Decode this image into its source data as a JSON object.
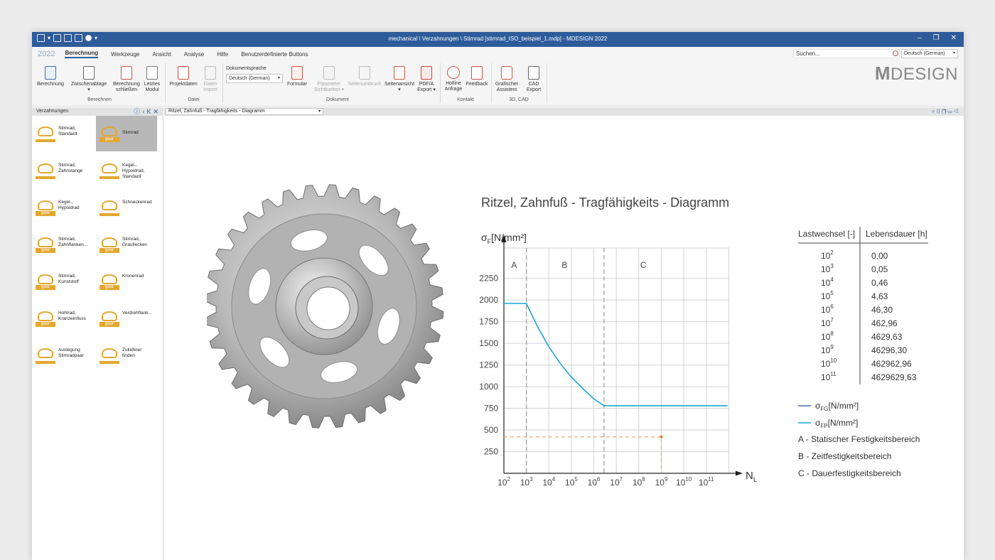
{
  "window": {
    "title": "mechanical \\ Verzahnungen \\ Stirnrad [stirnrad_ISO_beispiel_1.mdp] - MDESIGN 2022",
    "controls": [
      "–",
      "❐",
      "✕"
    ]
  },
  "menu": {
    "year": "2022",
    "items": [
      "Berechnung",
      "Werkzeuge",
      "Ansicht",
      "Analyse",
      "Hilfe",
      "Benutzerdefinierte Buttons"
    ],
    "search_text": "Suchen...",
    "language": "Deutsch (German)"
  },
  "ribbon": {
    "berechnen": {
      "group": "Berechnen",
      "buttons": [
        {
          "label1": "Berechnung",
          "label2": ""
        },
        {
          "label1": "Zwischenablage",
          "label2": "▾"
        },
        {
          "label1": "Berechnung",
          "label2": "schließen"
        },
        {
          "label1": "Letztes",
          "label2": "Modul"
        }
      ]
    },
    "datei": {
      "group": "Datei",
      "buttons": [
        {
          "label1": "Projektdaten",
          "label2": ""
        },
        {
          "label1": "Daten",
          "label2": "Import"
        }
      ]
    },
    "dokument": {
      "group": "Dokument",
      "sprache_label": "Dokumentsprache",
      "sprache_value": "Deutsch (German)",
      "buttons": [
        {
          "label1": "Formular",
          "label2": ""
        },
        {
          "label1": "Parameter",
          "label2": "Sichtbarkeit ▾"
        },
        {
          "label1": "Seitenumbruch",
          "label2": ""
        },
        {
          "label1": "Seitenansicht",
          "label2": "▾"
        },
        {
          "label1": "PDF/A",
          "label2": "Export ▾"
        }
      ]
    },
    "kontakt": {
      "group": "Kontakt",
      "buttons": [
        {
          "label1": "Hotline",
          "label2": "Anfrage"
        },
        {
          "label1": "Feedback",
          "label2": ""
        }
      ]
    },
    "cad": {
      "group": "3D, CAD",
      "buttons": [
        {
          "label1": "Grafischer",
          "label2": "Assistent"
        },
        {
          "label1": "CAD",
          "label2": "Export"
        }
      ]
    },
    "logo_m": "M",
    "logo_rest": "DESIGN"
  },
  "sidebar": {
    "title": "Verzahnungen",
    "items": [
      {
        "label1": "Stirnrad,",
        "label2": "Standard",
        "label3": "",
        "tag": ""
      },
      {
        "label1": "Stirnrad",
        "label2": "",
        "label3": "",
        "tag": "gear"
      },
      {
        "label1": "Stirnrad,",
        "label2": "Zahnstange",
        "label3": "",
        "tag": ""
      },
      {
        "label1": "Kegel-,",
        "label2": "Hypoidrad,",
        "label3": "Standard",
        "tag": ""
      },
      {
        "label1": "Kegel-,",
        "label2": "Hypoidrad",
        "label3": "",
        "tag": "gear"
      },
      {
        "label1": "Schneckenrad",
        "label2": "",
        "label3": "",
        "tag": ""
      },
      {
        "label1": "Stirnrad,",
        "label2": "Zahnflanken...",
        "label3": "",
        "tag": "gear"
      },
      {
        "label1": "Stirnrad,",
        "label2": "Graufiecken",
        "label3": "",
        "tag": "gear"
      },
      {
        "label1": "Stirnrad,",
        "label2": "Kunststoff",
        "label3": "",
        "tag": "gear"
      },
      {
        "label1": "Kronenrad",
        "label2": "",
        "label3": "",
        "tag": "gear"
      },
      {
        "label1": "Hohlrad,",
        "label2": "Kranzeinfluss",
        "label3": "",
        "tag": "gear"
      },
      {
        "label1": "Verdrehflank...",
        "label2": "",
        "label3": "",
        "tag": "gear"
      },
      {
        "label1": "Auslegung",
        "label2": "Stirnradpaar",
        "label3": "",
        "tag": ""
      },
      {
        "label1": "Zulieferer",
        "label2": "finden",
        "label3": "",
        "tag": ""
      }
    ]
  },
  "document": {
    "selector": "Ritzel, Zahnfuß - Tragfähigkeits - Diagramm"
  },
  "chart_data": {
    "type": "line",
    "title": "Ritzel, Zahnfuß - Tragfähigkeits - Diagramm",
    "ylabel_sym": "σ",
    "ylabel_sub": "F",
    "ylabel_unit": "[N/mm²]",
    "xlabel_sym": "N",
    "xlabel_sub": "L",
    "x_scale": "log10",
    "xlim_exp": [
      2,
      12
    ],
    "ylim": [
      0,
      2600
    ],
    "yticks": [
      250,
      500,
      750,
      1000,
      1250,
      1500,
      1750,
      2000,
      2250
    ],
    "xticks_exp": [
      "2",
      "3",
      "4",
      "5",
      "6",
      "7",
      "8",
      "9",
      "10",
      "11"
    ],
    "zones": [
      {
        "label": "A",
        "from_exp": 2,
        "to_exp": 3
      },
      {
        "label": "B",
        "from_exp": 3,
        "to_exp": 6.45
      },
      {
        "label": "C",
        "from_exp": 6.45,
        "to_exp": 12
      }
    ],
    "series": [
      {
        "name": "σ_FP",
        "color": "#1aa6d4",
        "points": [
          [
            2,
            1960
          ],
          [
            3,
            1960
          ],
          [
            3.5,
            1690
          ],
          [
            4,
            1460
          ],
          [
            4.5,
            1270
          ],
          [
            5,
            1110
          ],
          [
            5.5,
            980
          ],
          [
            6,
            860
          ],
          [
            6.45,
            780
          ],
          [
            12,
            780
          ]
        ]
      }
    ],
    "marker": {
      "x_exp": 9,
      "y": 420,
      "color": "#e8a060"
    },
    "legend_series": [
      {
        "sym": "σ",
        "sub": "FG",
        "unit": "[N/mm²]",
        "color": "#4a6fa5"
      },
      {
        "sym": "σ",
        "sub": "FP",
        "unit": "[N/mm²]",
        "color": "#1aa6d4"
      }
    ],
    "legend_zones": [
      "A - Statischer Festigkeitsbereich",
      "B - Zeitfestigkeitsbereich",
      "C - Dauerfestigkeitsbereich"
    ],
    "table": {
      "headers": [
        "Lastwechsel [-]",
        "Lebensdauer [h]"
      ],
      "rows": [
        {
          "exp": "2",
          "life": "0,00"
        },
        {
          "exp": "3",
          "life": "0,05"
        },
        {
          "exp": "4",
          "life": "0,46"
        },
        {
          "exp": "5",
          "life": "4,63"
        },
        {
          "exp": "6",
          "life": "46,30"
        },
        {
          "exp": "7",
          "life": "462,96"
        },
        {
          "exp": "8",
          "life": "4629,63"
        },
        {
          "exp": "9",
          "life": "46296,30"
        },
        {
          "exp": "10",
          "life": "462962,96"
        },
        {
          "exp": "11",
          "life": "4629629,63"
        }
      ]
    }
  }
}
